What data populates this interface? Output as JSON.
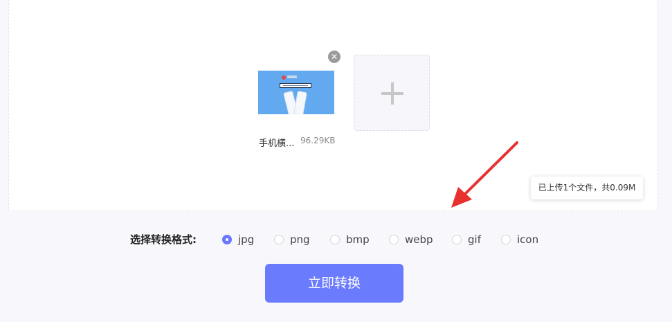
{
  "upload": {
    "file": {
      "name": "手机横...",
      "size": "96.29KB"
    },
    "close_symbol": "✕",
    "add_icon": "plus-icon"
  },
  "tooltip": {
    "text": "已上传1个文件，共0.09M"
  },
  "format": {
    "label": "选择转换格式:",
    "options": [
      "jpg",
      "png",
      "bmp",
      "webp",
      "gif",
      "icon"
    ],
    "selected": "jpg"
  },
  "convert_button": {
    "label": "立即转换"
  },
  "colors": {
    "accent": "#6b7bfe",
    "arrow": "#e8302f",
    "thumb_bg": "#63a9ef"
  }
}
